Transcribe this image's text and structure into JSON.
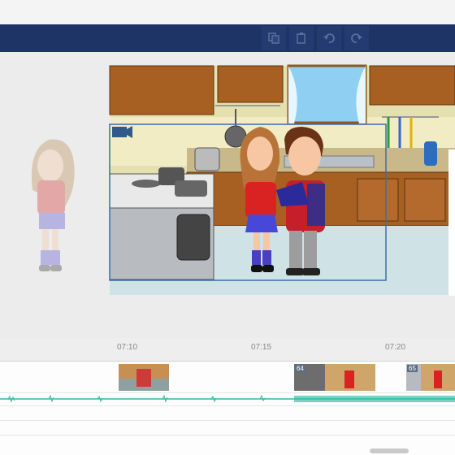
{
  "toolbar": {
    "buttons": [
      {
        "name": "copy-button",
        "icon": "copy-icon"
      },
      {
        "name": "paste-button",
        "icon": "paste-icon"
      },
      {
        "name": "undo-button",
        "icon": "undo-icon"
      },
      {
        "name": "redo-button",
        "icon": "redo-icon"
      }
    ],
    "bg": "#1f3466"
  },
  "timeline": {
    "ticks": [
      "07:10",
      "07:15",
      "07:20"
    ],
    "scene_numbers": [
      "64",
      "65"
    ],
    "audio_color": "#35b8a2"
  },
  "stage": {
    "camera_icon": "video-camera-icon"
  }
}
